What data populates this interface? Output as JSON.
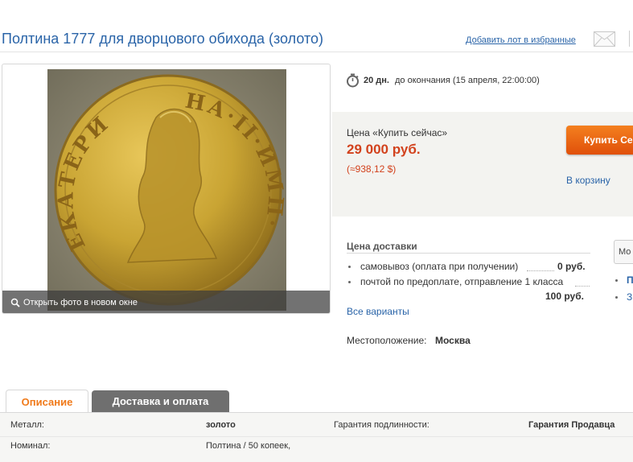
{
  "header": {
    "title": "Полтина 1777 для дворцового обихода (золото)",
    "favorite_link": "Добавить лот в избранные"
  },
  "photo": {
    "open_link": "Открыть фото в новом окне",
    "coin_legend_left": "ЕКАТЕРИ",
    "coin_legend_right": "НА·II·ИМП·"
  },
  "timer": {
    "days": "20 дн.",
    "rest": "до окончания (15 апреля, 22:00:00)"
  },
  "buy": {
    "price_label": "Цена «Купить сейчас»",
    "price": "29 000 руб.",
    "price_usd": "(≈938,12 $)",
    "button_label": "Купить Сейчас",
    "cart_link": "В корзину"
  },
  "delivery": {
    "title": "Цена доставки",
    "options": [
      {
        "label": "самовывоз (оплата при получении)",
        "price": "0 руб."
      },
      {
        "label": "почтой по предоплате, отправление 1 класса",
        "price": "100 руб."
      }
    ],
    "all_variants": "Все варианты"
  },
  "location": {
    "label": "Местоположение:",
    "value": "Москва"
  },
  "side": {
    "button_label": "Мо",
    "link_1": "П",
    "link_2": "З"
  },
  "tabs": [
    {
      "label": "Описание",
      "active": true
    },
    {
      "label": "Доставка и оплата",
      "active": false
    }
  ],
  "attributes": [
    {
      "name": "Металл:",
      "value": "золото",
      "name2": "Гарантия подлинности:",
      "value2": "Гарантия Продавца"
    },
    {
      "name": "Номинал:",
      "value": "Полтина / 50 копеек,"
    }
  ],
  "colors": {
    "link": "#2a64a8",
    "price": "#d2421d",
    "accent": "#f07a1a",
    "gold": "#c9a433"
  }
}
